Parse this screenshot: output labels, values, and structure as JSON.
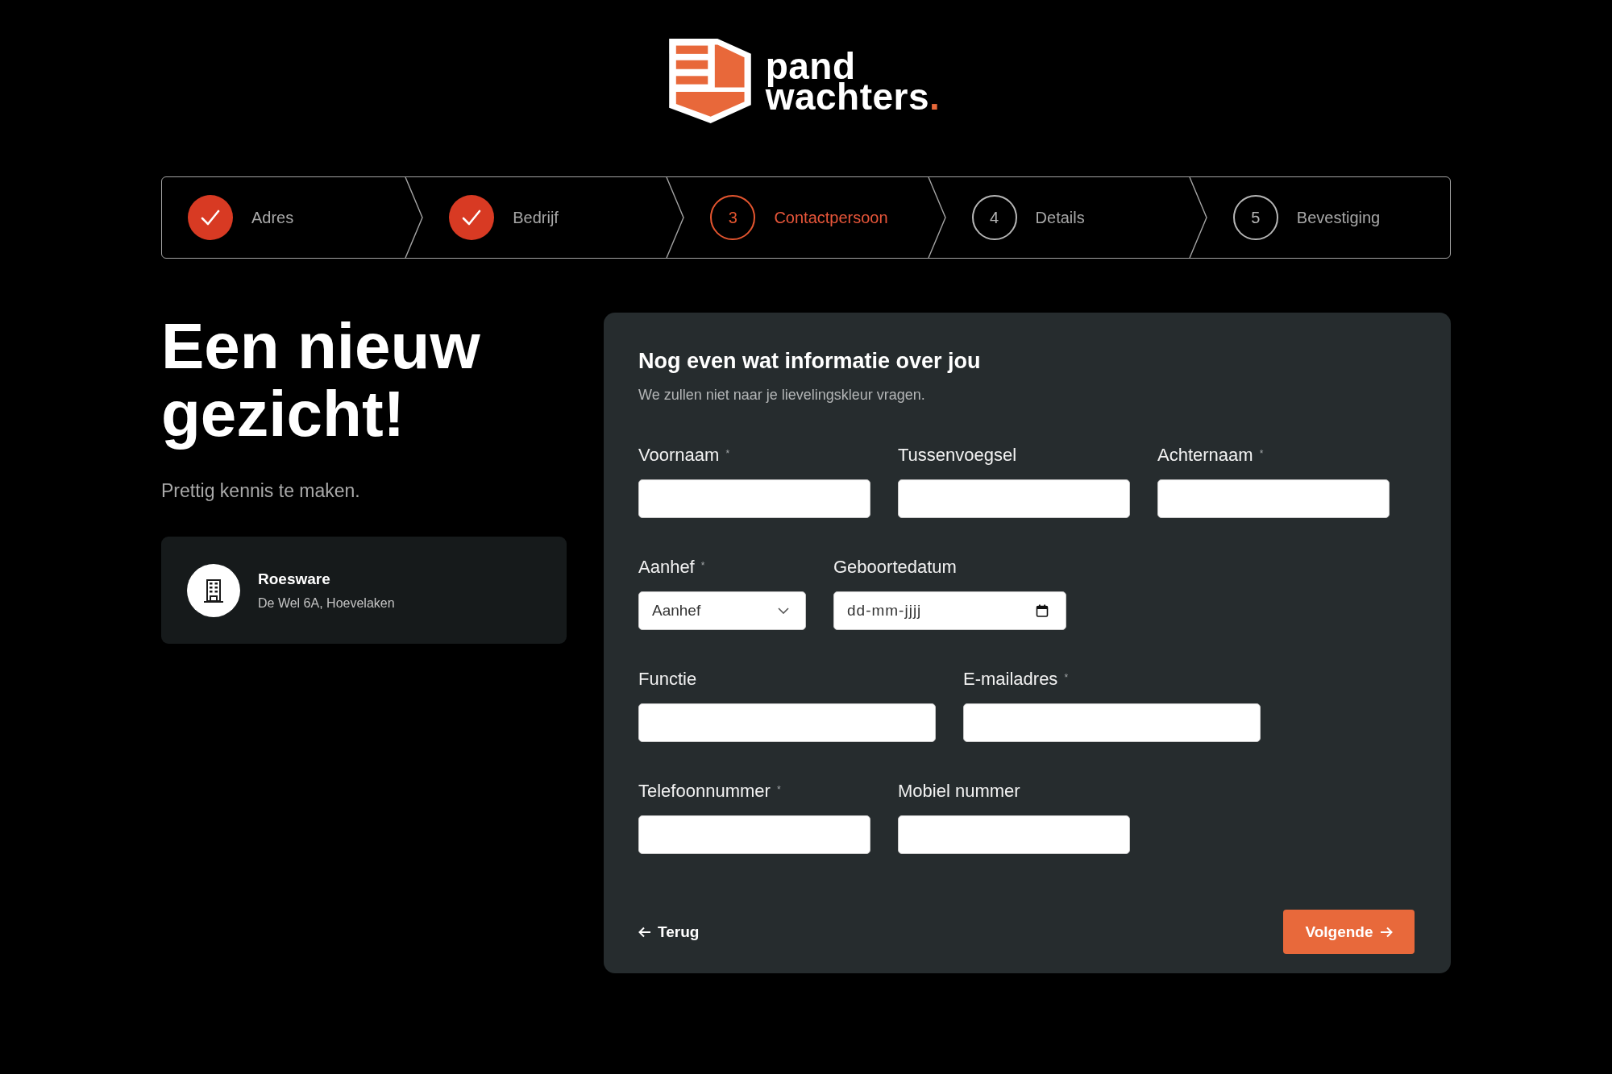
{
  "logo": {
    "line_1": "pand",
    "line_2": "wachters",
    "accent": "."
  },
  "steps": [
    {
      "label": "Adres",
      "completed": true,
      "selected": false
    },
    {
      "label": "Bedrijf",
      "completed": true,
      "selected": false
    },
    {
      "number": "3",
      "label": "Contactpersoon",
      "completed": false,
      "selected": true
    },
    {
      "number": "4",
      "label": "Details",
      "completed": false,
      "selected": false
    },
    {
      "number": "5",
      "label": "Bevestiging",
      "completed": false,
      "selected": false
    }
  ],
  "intro": {
    "heading": "Een nieuw gezicht!",
    "subheading": "Prettig kennis te maken."
  },
  "company_card": {
    "name": "Roesware",
    "address": "De Wel 6A, Hoevelaken"
  },
  "form": {
    "title": "Nog even wat informatie over jou",
    "subtitle": "We zullen niet naar je lievelingskleur vragen.",
    "rows": [
      {
        "fields": [
          {
            "kind": "text",
            "label": "Voornaam $^{*}$"
          },
          {
            "kind": "text",
            "label": "Tussenvoegsel"
          },
          {
            "kind": "text",
            "label": "Achternaam $^{*}$"
          }
        ]
      },
      {
        "fields": [
          {
            "kind": "select",
            "label": "Aanhef $^{*}$",
            "value": "Aanhef"
          },
          {
            "kind": "date",
            "label": "Geboortedatum",
            "placeholder": "dd-mm-jjjj"
          }
        ]
      },
      {
        "fields": [
          {
            "kind": "text",
            "label": "Functie"
          },
          {
            "kind": "text",
            "label": "E-mailadres $^{*}$"
          }
        ]
      },
      {
        "fields": [
          {
            "kind": "text",
            "label": "Telefoonnummer $^{*}$"
          },
          {
            "kind": "text",
            "label": "Mobiel nummer"
          }
        ]
      }
    ],
    "back_button": {
      "label": "Terug"
    },
    "next_button": {
      "label": "Volgende"
    }
  }
}
